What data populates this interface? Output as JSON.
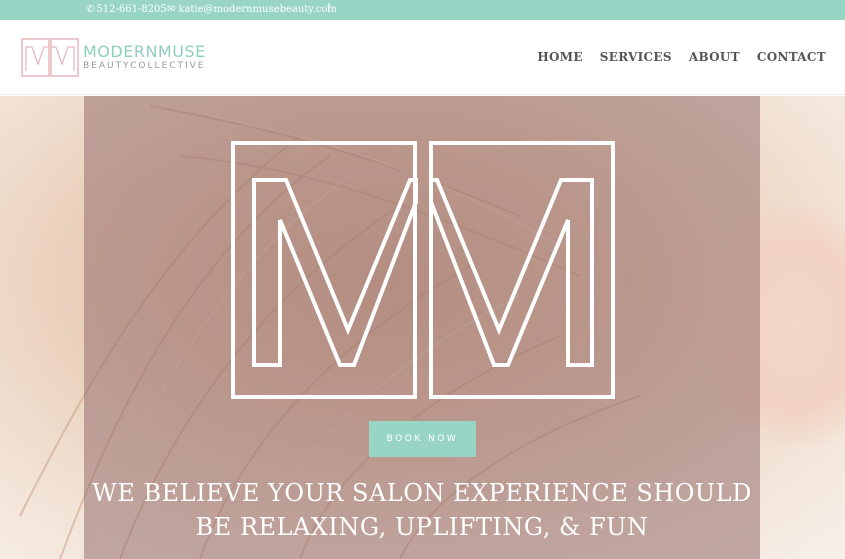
{
  "topbar": {
    "phone": "512-661-8205",
    "email": "katie@modernmusebeauty.com",
    "phone_icon": "phone-icon",
    "email_icon": "envelope-icon",
    "social_icon": "facebook-icon",
    "social_glyph": "f",
    "background": "#98d5c4"
  },
  "brand": {
    "name_part1": "MODERN",
    "name_part2": "MUSE",
    "tagline": "BEAUTYCOLLECTIVE",
    "accent": "#98d5c4",
    "logo_pink": "#e8b8bf"
  },
  "nav": {
    "items": [
      {
        "label": "HOME"
      },
      {
        "label": "SERVICES"
      },
      {
        "label": "ABOUT"
      },
      {
        "label": "CONTACT"
      }
    ]
  },
  "hero": {
    "button_label": "BOOK NOW",
    "headline_line1": "WE BELIEVE YOUR SALON EXPERIENCE SHOULD",
    "headline_line2": "BE RELAXING, UPLIFTING, & FUN"
  }
}
